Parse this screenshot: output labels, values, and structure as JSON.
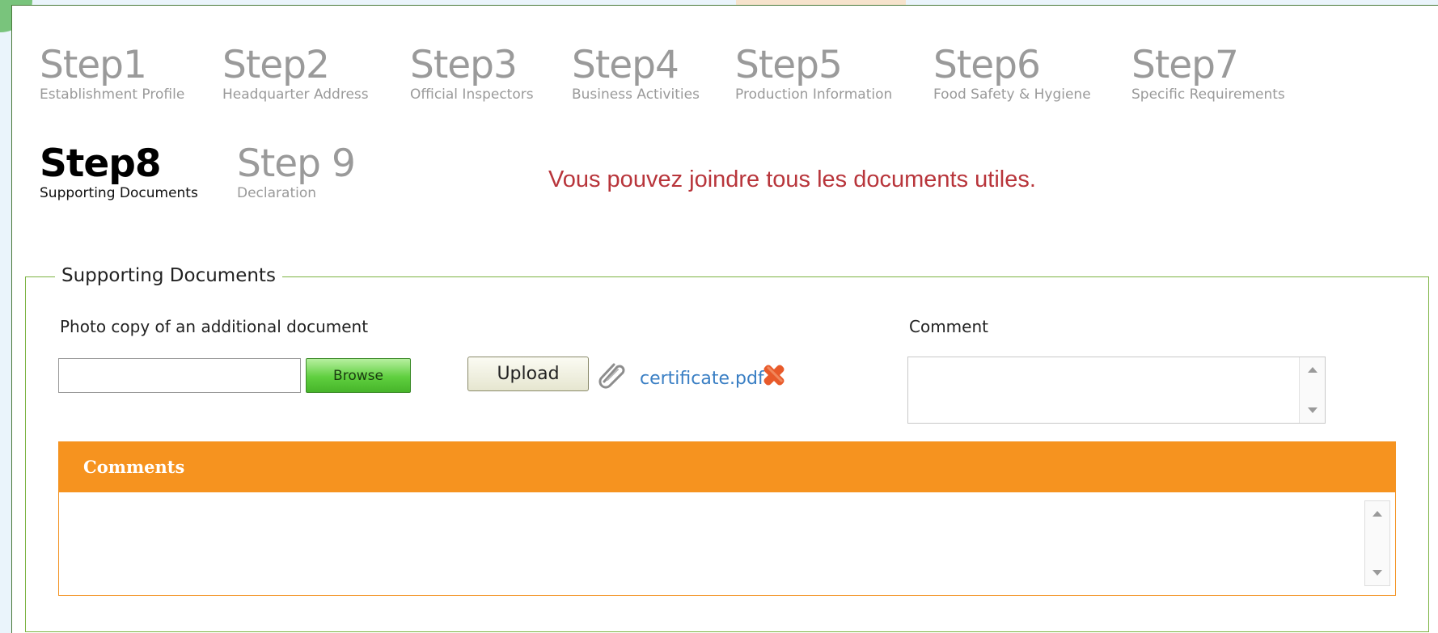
{
  "steps_row1": [
    {
      "title": "Step1",
      "subtitle": "Establishment Profile"
    },
    {
      "title": "Step2",
      "subtitle": "Headquarter Address"
    },
    {
      "title": "Step3",
      "subtitle": "Official Inspectors"
    },
    {
      "title": "Step4",
      "subtitle": "Business Activities"
    },
    {
      "title": "Step5",
      "subtitle": "Production Information"
    },
    {
      "title": "Step6",
      "subtitle": "Food Safety & Hygiene"
    },
    {
      "title": "Step7",
      "subtitle": "Specific Requirements"
    }
  ],
  "steps_row2": [
    {
      "title": "Step8",
      "subtitle": "Supporting Documents",
      "active": true
    },
    {
      "title": "Step 9",
      "subtitle": "Declaration"
    }
  ],
  "info_message": "Vous pouvez joindre tous les documents utiles.",
  "section": {
    "legend": "Supporting Documents",
    "document_label": "Photo copy of an additional document",
    "file_input_value": "",
    "browse_label": "Browse",
    "upload_label": "Upload",
    "attached_file": "certificate.pdf",
    "comment_label": "Comment",
    "comment_value": ""
  },
  "comments_panel": {
    "title": "Comments",
    "body": ""
  },
  "icons": {
    "attachment": "paperclip-icon",
    "remove": "close-x-icon"
  },
  "colors": {
    "accent_orange": "#f6931f",
    "border_green": "#7cb342",
    "message_red": "#b8353b",
    "link_blue": "#3a7fc4"
  }
}
